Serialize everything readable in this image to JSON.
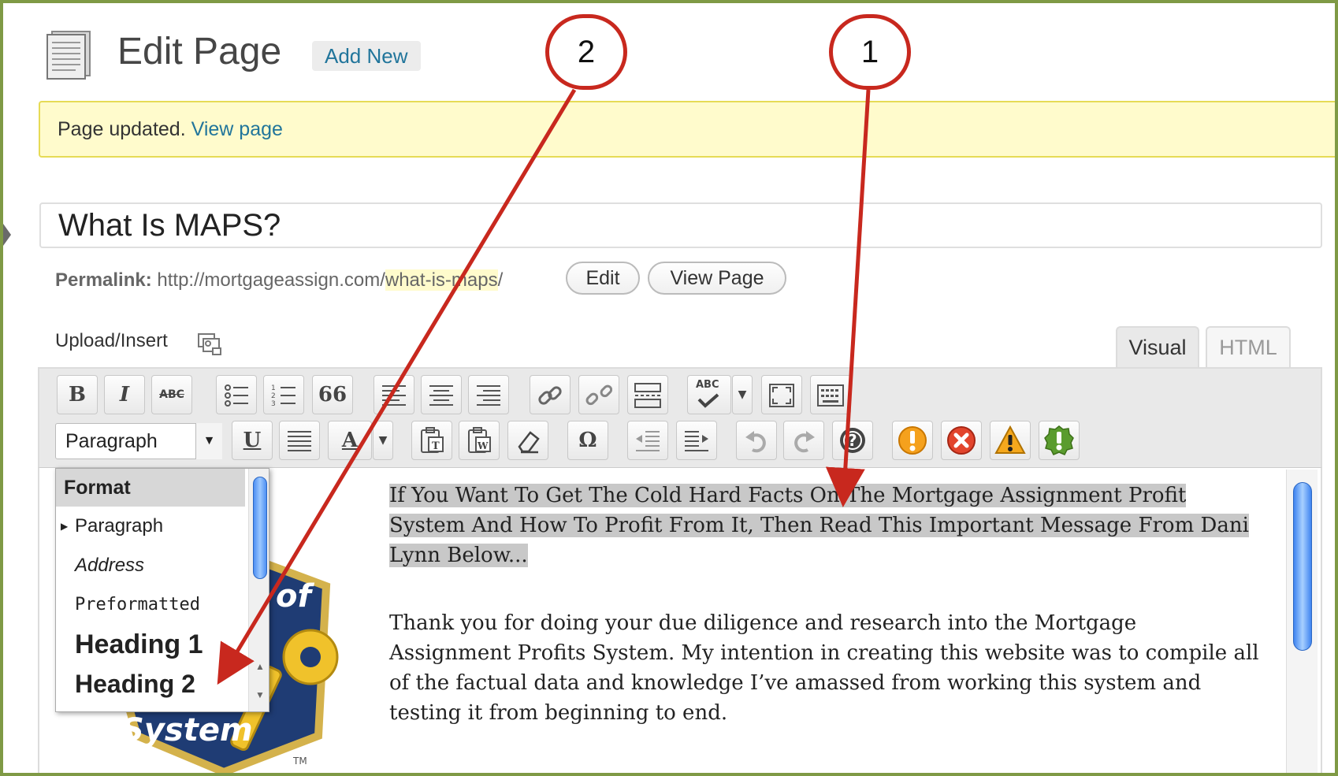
{
  "header": {
    "title": "Edit Page",
    "add_new": "Add New"
  },
  "notice": {
    "text": "Page updated.",
    "link": "View page"
  },
  "post": {
    "title": "What Is MAPS?"
  },
  "permalink": {
    "label": "Permalink:",
    "base": "http://mortgageassign.com/",
    "slug": "what-is-maps",
    "trail": "/",
    "edit_button": "Edit",
    "view_button": "View Page"
  },
  "upload": {
    "label": "Upload/Insert"
  },
  "tabs": {
    "visual": "Visual",
    "html": "HTML"
  },
  "toolbar": {
    "bold": "B",
    "italic": "I",
    "strike": "ABC",
    "blockquote": "66",
    "spell": "ABC",
    "underline": "U",
    "omega": "Ω",
    "format_value": "Paragraph"
  },
  "format_dropdown": {
    "header": "Format",
    "items": [
      "Paragraph",
      "Address",
      "Preformatted",
      "Heading 1",
      "Heading 2"
    ]
  },
  "content": {
    "highlight": "If You Want To Get The Cold Hard Facts On The Mortgage Assignment Profit System And How To Profit From It, Then Read This Important Message From Dani Lynn Below...",
    "paragraph": "Thank you for doing your due diligence and research into the Mortgage Assignment Profits System. My intention in creating this website was to compile all of the factual data and knowledge I’ve amassed from working this system and testing it from beginning to end."
  },
  "logo": {
    "text_of": "of",
    "text_system": "System",
    "tm": "TM"
  },
  "annotations": {
    "callout_1": "1",
    "callout_2": "2",
    "color": "#c8281e"
  }
}
